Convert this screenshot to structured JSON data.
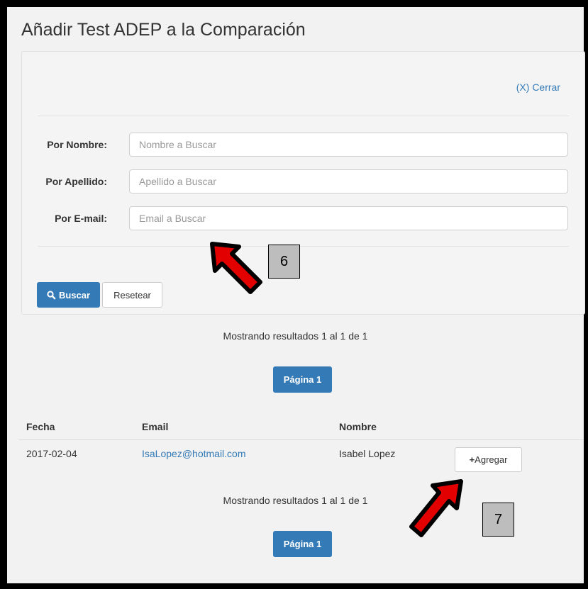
{
  "title": "Añadir Test ADEP a la Comparación",
  "search_panel": {
    "close_label": "(X) Cerrar",
    "fields": [
      {
        "label": "Por Nombre:",
        "placeholder": "Nombre a Buscar",
        "value": ""
      },
      {
        "label": "Por Apellido:",
        "placeholder": "Apellido a Buscar",
        "value": ""
      },
      {
        "label": "Por E-mail:",
        "placeholder": "Email a Buscar",
        "value": ""
      }
    ],
    "search_button": "Buscar",
    "reset_button": "Resetear"
  },
  "results_summary": "Mostrando resultados 1 al 1 de 1",
  "pagination": {
    "label": "Página 1"
  },
  "table": {
    "headers": [
      "Fecha",
      "Email",
      "Nombre"
    ],
    "rows": [
      {
        "fecha": "2017-02-04",
        "email": "IsaLopez@hotmail.com",
        "nombre": "Isabel Lopez",
        "action": "Agregar"
      }
    ]
  },
  "annotations": {
    "callout_6": "6",
    "callout_7": "7",
    "arrow_color": "#e30000"
  },
  "colors": {
    "primary": "#337ab7",
    "background": "#f2f2f2"
  }
}
